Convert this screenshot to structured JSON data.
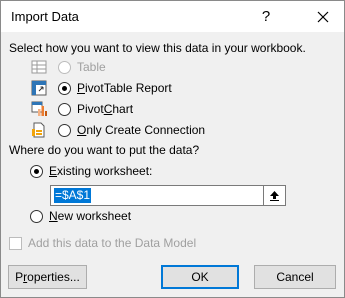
{
  "dialog": {
    "title": "Import Data",
    "help_icon": "question-mark-icon",
    "close_icon": "close-x-icon"
  },
  "view": {
    "prompt": "Select how you want to view this data in your workbook.",
    "options": [
      {
        "label": "Table",
        "state": "disabled",
        "icon": "table-icon"
      },
      {
        "label_pre": "",
        "label_u": "P",
        "label_post": "ivotTable Report",
        "state": "checked",
        "icon": "pivottable-icon"
      },
      {
        "label_pre": "Pivot",
        "label_u": "C",
        "label_post": "hart",
        "state": "unchecked",
        "icon": "pivotchart-icon"
      },
      {
        "label_pre": "",
        "label_u": "O",
        "label_post": "nly Create Connection",
        "state": "unchecked",
        "icon": "connection-icon"
      }
    ]
  },
  "destination": {
    "prompt": "Where do you want to put the data?",
    "existing": {
      "label_u": "E",
      "label_post": "xisting worksheet:",
      "state": "checked"
    },
    "range_value": "=$A$1",
    "new": {
      "label_u": "N",
      "label_post": "ew worksheet",
      "state": "unchecked"
    }
  },
  "data_model": {
    "label": "Add this data to the Data Model",
    "state": "disabled"
  },
  "buttons": {
    "properties_pre": "P",
    "properties_u": "r",
    "properties_post": "operties...",
    "ok": "OK",
    "cancel": "Cancel"
  },
  "colors": {
    "accent": "#0078d7",
    "dialog_bg": "#f0f0f0",
    "disabled_text": "#a0a0a0"
  }
}
